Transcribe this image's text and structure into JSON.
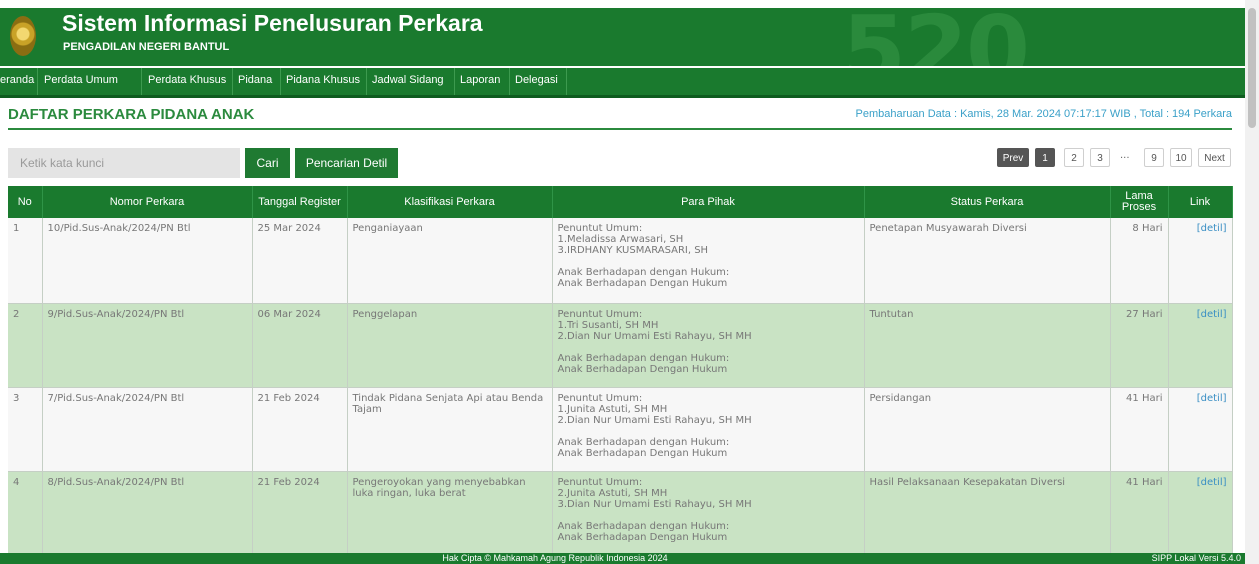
{
  "header": {
    "app_title": "Sistem Informasi Penelusuran Perkara",
    "court_name": "PENGADILAN NEGERI BANTUL",
    "backdrop_text": "520"
  },
  "nav": {
    "items": [
      "eranda",
      "Perdata Umum",
      "Perdata Khusus",
      "Pidana",
      "Pidana Khusus",
      "Jadwal Sidang",
      "Laporan",
      "Delegasi"
    ]
  },
  "page": {
    "title": "DAFTAR PERKARA PIDANA ANAK",
    "update_info": "Pembaharuan Data : Kamis, 28 Mar. 2024 07:17:17 WIB , Total : 194 Perkara"
  },
  "search": {
    "placeholder": "Ketik kata kunci",
    "search_button": "Cari",
    "advanced_button": "Pencarian Detil"
  },
  "pagination": {
    "prev": "Prev",
    "pages": [
      "1",
      "2",
      "3"
    ],
    "ellipsis": "...",
    "tail_pages": [
      "9",
      "10"
    ],
    "next": "Next"
  },
  "table": {
    "headers": {
      "no": "No",
      "nomor": "Nomor Perkara",
      "tanggal": "Tanggal Register",
      "klasifikasi": "Klasifikasi Perkara",
      "pihak": "Para Pihak",
      "status": "Status Perkara",
      "lama": "Lama Proses",
      "link": "Link"
    },
    "rows": [
      {
        "no": "1",
        "nomor": "10/Pid.Sus-Anak/2024/PN Btl",
        "tanggal": "25 Mar 2024",
        "klasifikasi": "Penganiayaan",
        "pihak": [
          "Penuntut Umum:",
          "1.Meladissa Arwasari, SH",
          "3.IRDHANY KUSMARASARI, SH",
          "",
          "Anak Berhadapan dengan Hukum:",
          "Anak Berhadapan Dengan Hukum"
        ],
        "status": "Penetapan Musyawarah Diversi",
        "lama": "8 Hari",
        "link": "[detil]"
      },
      {
        "no": "2",
        "nomor": "9/Pid.Sus-Anak/2024/PN Btl",
        "tanggal": "06 Mar 2024",
        "klasifikasi": "Penggelapan",
        "pihak": [
          "Penuntut Umum:",
          "1.Tri Susanti, SH MH",
          "2.Dian Nur Umami Esti Rahayu, SH MH",
          "",
          "Anak Berhadapan dengan Hukum:",
          "Anak Berhadapan Dengan Hukum"
        ],
        "status": "Tuntutan",
        "lama": "27 Hari",
        "link": "[detil]"
      },
      {
        "no": "3",
        "nomor": "7/Pid.Sus-Anak/2024/PN Btl",
        "tanggal": "21 Feb 2024",
        "klasifikasi": "Tindak Pidana Senjata Api atau Benda Tajam",
        "pihak": [
          "Penuntut Umum:",
          "1.Junita Astuti, SH MH",
          "2.Dian Nur Umami Esti Rahayu, SH MH",
          "",
          "Anak Berhadapan dengan Hukum:",
          "Anak Berhadapan Dengan Hukum"
        ],
        "status": "Persidangan",
        "lama": "41 Hari",
        "link": "[detil]"
      },
      {
        "no": "4",
        "nomor": "8/Pid.Sus-Anak/2024/PN Btl",
        "tanggal": "21 Feb 2024",
        "klasifikasi": "Pengeroyokan yang menyebabkan luka ringan, luka berat",
        "pihak": [
          "Penuntut Umum:",
          "2.Junita Astuti, SH MH",
          "3.Dian Nur Umami Esti Rahayu, SH MH",
          "",
          "Anak Berhadapan dengan Hukum:",
          "Anak Berhadapan Dengan Hukum"
        ],
        "status": "Hasil Pelaksanaan Kesepakatan Diversi",
        "lama": "41 Hari",
        "link": "[detil]"
      }
    ]
  },
  "footer": {
    "copyright": "Hak Cipta © Mahkamah Agung Republik Indonesia 2024",
    "version": "SIPP Lokal Versi 5.4.0"
  },
  "colors": {
    "primary_green": "#1a7a2e",
    "row_green": "#c9e3c4",
    "title_green": "#2b8a3e",
    "link_blue": "#3a8fc4"
  }
}
